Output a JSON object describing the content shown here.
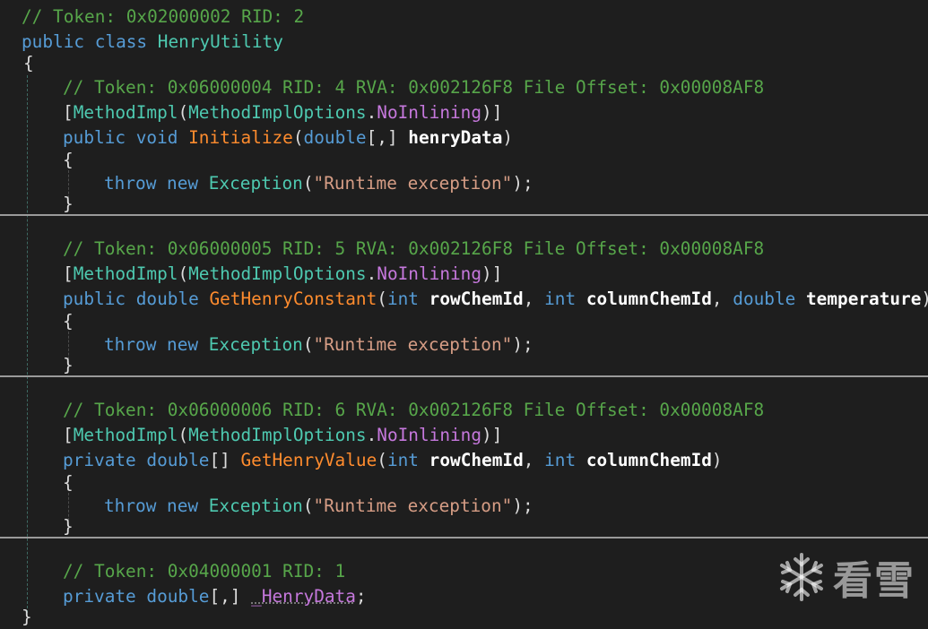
{
  "editor": {
    "class_comment": "// Token: 0x02000002 RID: 2",
    "class_decl": {
      "mod1": "public",
      "mod2": "class",
      "name": "HenryUtility"
    },
    "brace_open": "{",
    "brace_close": "}",
    "methods": [
      {
        "comment": "// Token: 0x06000004 RID: 4 RVA: 0x002126F8 File Offset: 0x00008AF8",
        "attr": {
          "open": "[",
          "name": "MethodImpl",
          "paren_open": "(",
          "enum_type": "MethodImplOptions",
          "dot": ".",
          "enum_val": "NoInlining",
          "paren_close": ")",
          "close": "]"
        },
        "sig": {
          "mod": "public ",
          "ret": "void",
          "name": " Initialize",
          "open": "(",
          "params": [
            {
              "type": "double",
              "suffix": "[,] ",
              "name": "henryData"
            }
          ],
          "close": ")"
        },
        "body": {
          "kw1": "throw",
          "kw2": " new ",
          "type": "Exception",
          "open": "(",
          "str": "\"Runtime exception\"",
          "close": ");"
        }
      },
      {
        "comment": "// Token: 0x06000005 RID: 5 RVA: 0x002126F8 File Offset: 0x00008AF8",
        "attr": {
          "open": "[",
          "name": "MethodImpl",
          "paren_open": "(",
          "enum_type": "MethodImplOptions",
          "dot": ".",
          "enum_val": "NoInlining",
          "paren_close": ")",
          "close": "]"
        },
        "sig": {
          "mod": "public ",
          "ret": "double",
          "name": " GetHenryConstant",
          "open": "(",
          "params": [
            {
              "type": "int",
              "suffix": " ",
              "name": "rowChemId",
              "sep": ", "
            },
            {
              "type": "int",
              "suffix": " ",
              "name": "columnChemId",
              "sep": ", "
            },
            {
              "type": "double",
              "suffix": " ",
              "name": "temperature"
            }
          ],
          "close": ")"
        },
        "body": {
          "kw1": "throw",
          "kw2": " new ",
          "type": "Exception",
          "open": "(",
          "str": "\"Runtime exception\"",
          "close": ");"
        }
      },
      {
        "comment": "// Token: 0x06000006 RID: 6 RVA: 0x002126F8 File Offset: 0x00008AF8",
        "attr": {
          "open": "[",
          "name": "MethodImpl",
          "paren_open": "(",
          "enum_type": "MethodImplOptions",
          "dot": ".",
          "enum_val": "NoInlining",
          "paren_close": ")",
          "close": "]"
        },
        "sig": {
          "mod": "private ",
          "ret": "double",
          "ret_suffix": "[]",
          "name": " GetHenryValue",
          "open": "(",
          "params": [
            {
              "type": "int",
              "suffix": " ",
              "name": "rowChemId",
              "sep": ", "
            },
            {
              "type": "int",
              "suffix": " ",
              "name": "columnChemId"
            }
          ],
          "close": ")"
        },
        "body": {
          "kw1": "throw",
          "kw2": " new ",
          "type": "Exception",
          "open": "(",
          "str": "\"Runtime exception\"",
          "close": ");"
        }
      }
    ],
    "field": {
      "comment": "// Token: 0x04000001 RID: 1",
      "mod": "private ",
      "type": "double",
      "suffix": "[,] ",
      "name": "_HenryData",
      "end": ";"
    }
  },
  "watermark": {
    "text": "看雪",
    "icon": "snowflake-icon"
  },
  "colors": {
    "background": "#1e1e1e",
    "comment": "#57a64a",
    "keyword": "#569cd6",
    "type": "#4ec9b0",
    "method": "#ff8c2e",
    "string": "#d69d85",
    "enum_value": "#c678dd"
  }
}
